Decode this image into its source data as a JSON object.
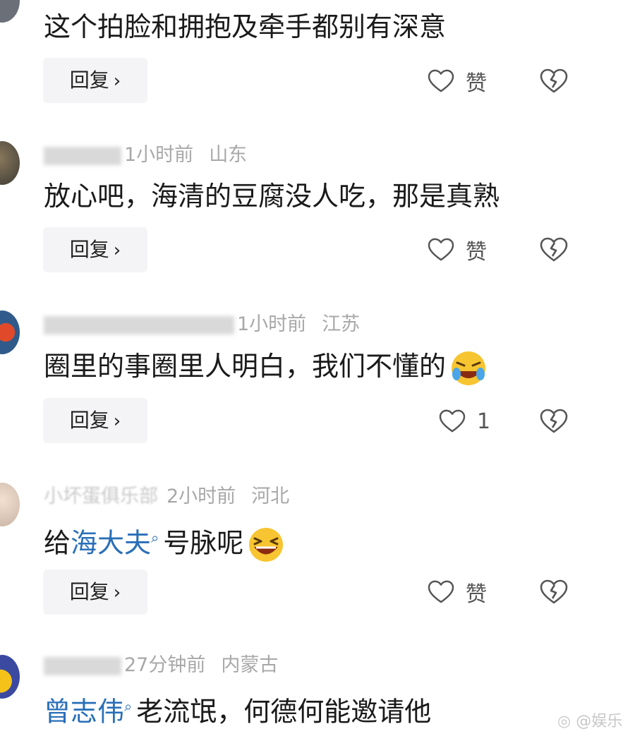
{
  "comments": [
    {
      "text": "这个拍脸和拥抱及牵手都别有深意",
      "reply_label": "回复",
      "like_label": "赞"
    },
    {
      "username_visible": "1小时前",
      "location": "山东",
      "text": "放心吧，海清的豆腐没人吃，那是真熟",
      "reply_label": "回复",
      "like_label": "赞"
    },
    {
      "time": "1小时前",
      "location": "江苏",
      "text": "圈里的事圈里人明白，我们不懂的",
      "reply_label": "回复",
      "like_count": "1"
    },
    {
      "username_partial": "小坏蛋俱乐部",
      "time": "2小时前",
      "location": "河北",
      "text_prefix": "给",
      "text_link": "海大夫",
      "text_suffix": "号脉呢",
      "reply_label": "回复",
      "like_label": "赞"
    },
    {
      "time": "27分钟前",
      "location": "内蒙古",
      "text_link": "曾志伟",
      "text_suffix": "老流氓，何德何能邀请他"
    }
  ],
  "icons": {
    "like": "heart-outline-icon",
    "dislike": "broken-heart-icon",
    "chevron": "chevron-right-icon",
    "search": "magnifier-icon"
  },
  "watermark": "娱乐",
  "colors": {
    "link": "#2a6fb8",
    "meta": "#a8a8a8",
    "button_bg": "#f4f4f6"
  }
}
